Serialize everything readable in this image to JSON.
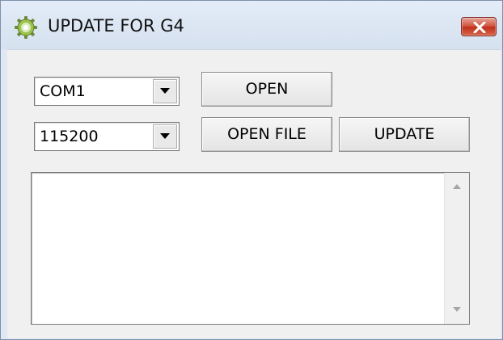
{
  "window": {
    "title": "UPDATE FOR G4",
    "icon": "gear-icon",
    "close_icon": "close-icon"
  },
  "port": {
    "selected": "COM1"
  },
  "baud": {
    "selected": "115200"
  },
  "buttons": {
    "open": "OPEN",
    "open_file": "OPEN FILE",
    "update": "UPDATE"
  },
  "log": {
    "text": ""
  },
  "colors": {
    "titlebar": "#dfe8f3",
    "client": "#f0f0f0",
    "close_button": "#c9432f"
  }
}
